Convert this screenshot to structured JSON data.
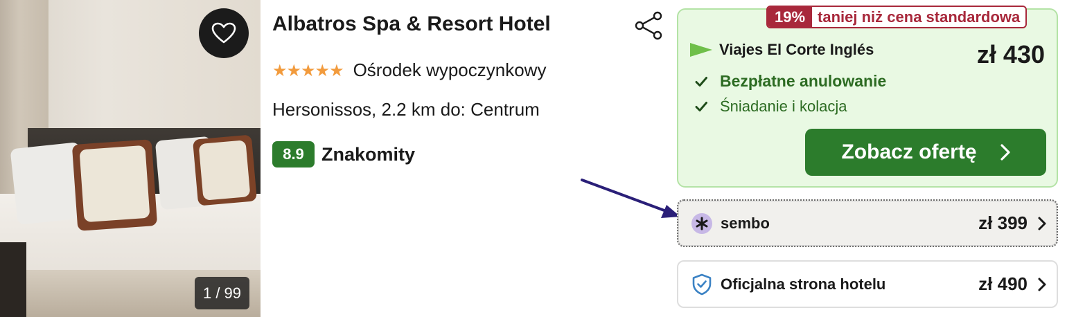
{
  "gallery": {
    "counter": "1 / 99",
    "favorite_icon": "heart-outline-icon"
  },
  "hotel": {
    "name": "Albatros Spa & Resort Hotel",
    "stars": "★★★★★",
    "star_count": 5,
    "type": "Ośrodek wypoczynkowy",
    "location": "Hersonissos, 2.2 km do: Centrum",
    "review_score": "8.9",
    "review_label": "Znakomity"
  },
  "deal": {
    "discount_pct": "19%",
    "discount_text": "taniej niż cena standardowa",
    "provider": "Viajes El Corte Inglés",
    "price": "zł 430",
    "features": [
      "Bezpłatne anulowanie",
      "Śniadanie i kolacja"
    ],
    "cta_label": "Zobacz ofertę"
  },
  "offers": [
    {
      "provider": "sembo",
      "price": "zł 399",
      "icon": "sembo-logo-icon"
    },
    {
      "provider": "Oficjalna strona hotelu",
      "price": "zł 490",
      "icon": "shield-check-icon"
    }
  ],
  "colors": {
    "accent_green": "#2c7c2c",
    "discount_red": "#a8283b",
    "deal_background": "#e9f9e3",
    "star_orange": "#f29b3d",
    "arrow_annotation": "#2a1f78"
  }
}
